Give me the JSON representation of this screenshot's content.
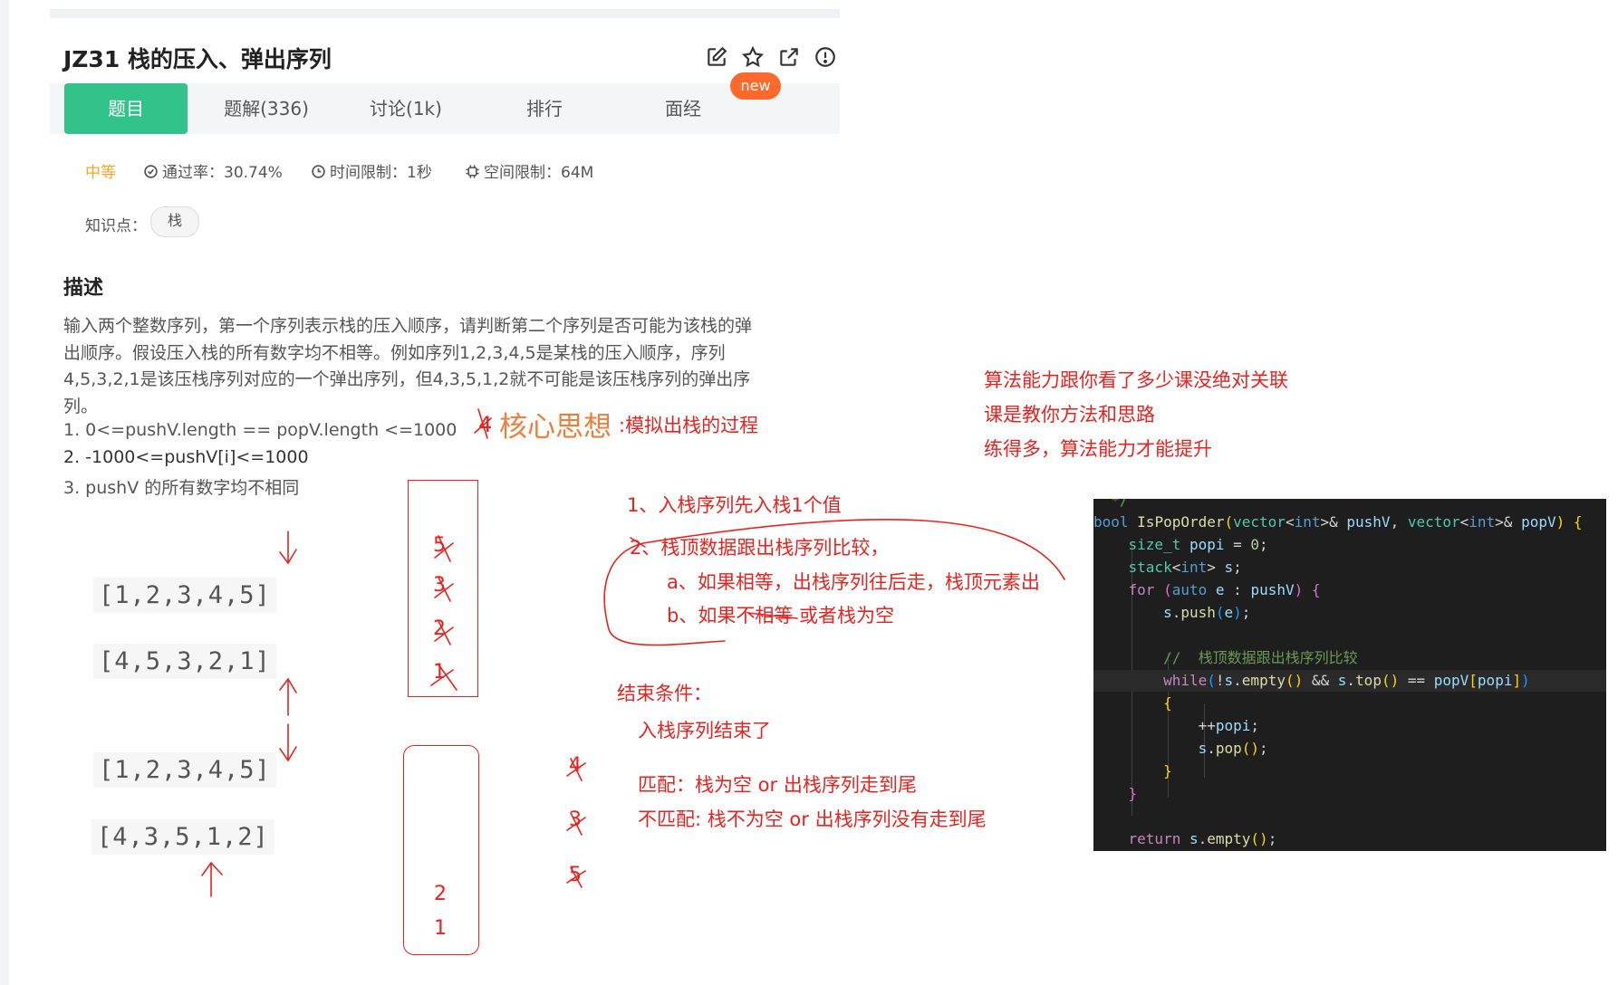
{
  "header": {
    "title": "JZ31  栈的压入、弹出序列",
    "icons": [
      "edit-icon",
      "star-icon",
      "share-icon",
      "info-icon"
    ]
  },
  "tabs": [
    {
      "label": "题目",
      "active": true
    },
    {
      "label": "题解(336)",
      "active": false
    },
    {
      "label": "讨论(1k)",
      "active": false
    },
    {
      "label": "排行",
      "active": false
    },
    {
      "label": "面经",
      "active": false
    }
  ],
  "new_badge": "new",
  "meta": {
    "difficulty": "中等",
    "pass_rate": "通过率：30.74%",
    "time_limit": "时间限制：1秒",
    "space_limit": "空间限制：64M"
  },
  "knowledge": {
    "label": "知识点：",
    "tag": "栈"
  },
  "description": {
    "title": "描述",
    "lines": [
      "输入两个整数序列，第一个序列表示栈的压入顺序，请判断第二个序列是否可能为该栈的弹",
      "出顺序。假设压入栈的所有数字均不相等。例如序列1,2,3,4,5是某栈的压入顺序，序列",
      "4,5,3,2,1是该压栈序列对应的一个弹出序列，但4,3,5,1,2就不可能是该压栈序列的弹出序",
      "列。",
      "1. 0<=pushV.length == popV.length <=1000",
      "2. -1000<=pushV[i]<=1000",
      "3. pushV 的所有数字均不相同"
    ]
  },
  "arrays": {
    "push1": "[1,2,3,4,5]",
    "pop1": "[4,5,3,2,1]",
    "push2": "[1,2,3,4,5]",
    "pop2": "[4,3,5,1,2]"
  },
  "stack1": [
    "5",
    "3",
    "2",
    "1"
  ],
  "stack2": [
    "2",
    "1"
  ],
  "popped2": [
    "4",
    "3",
    "5"
  ],
  "annotations": {
    "core_num": "4",
    "core_big": "核心思想",
    "core_rest": ":模拟出栈的过程",
    "step1": "1、入栈序列先入栈1个值",
    "step2": "2、栈顶数据跟出栈序列比较，",
    "step2a": "a、如果相等，出栈序列往后走，栈顶元素出",
    "step2b": "b、如果不相等  或者栈为空",
    "end_title": "结束条件：",
    "end_1": "入栈序列结束了",
    "match": "匹配：栈为空   or   出栈序列走到尾",
    "nomatch": "不匹配: 栈不为空   or   出栈序列没有走到尾",
    "side_1": "算法能力跟你看了多少课没绝对关联",
    "side_2": "课是教你方法和思路",
    "side_3": "练得多，算法能力才能提升"
  },
  "code": [
    "  */",
    "bool IsPopOrder(vector<int>& pushV, vector<int>& popV) {",
    "    size_t popi = 0;",
    "    stack<int> s;",
    "    for (auto e : pushV) {",
    "        s.push(e);",
    "",
    "        //  栈顶数据跟出栈序列比较",
    "        while(!s.empty() && s.top() == popV[popi])",
    "        {",
    "            ++popi;",
    "            s.pop();",
    "        }",
    "    }",
    "",
    "    return s.empty();"
  ],
  "colors": {
    "accent": "#32c38b",
    "badge": "#ff6a2c",
    "ink_red": "#e8231f",
    "core_orange": "#f07d3a",
    "difficulty": "#f5a623"
  }
}
